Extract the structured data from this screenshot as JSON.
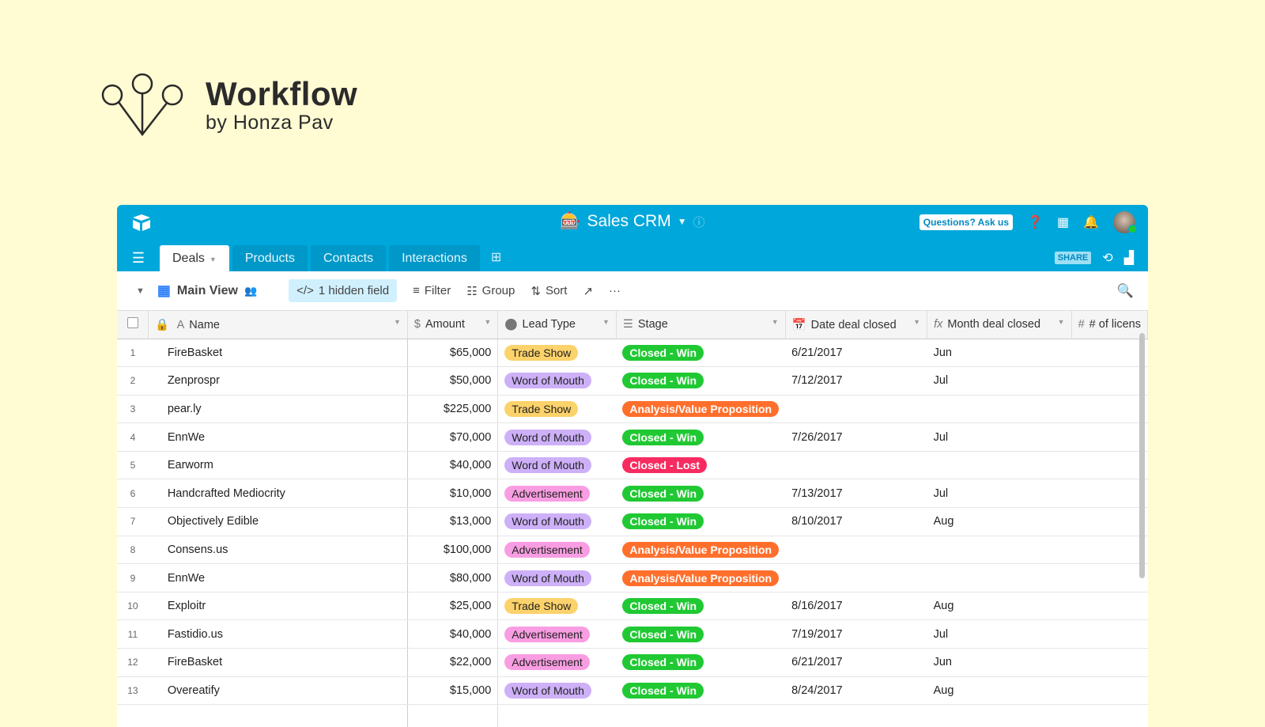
{
  "brand": {
    "title": "Workflow",
    "subtitle": "by Honza Pav"
  },
  "app": {
    "base_name": "Sales CRM",
    "help_button": "Questions? Ask us",
    "share_label": "SHARE",
    "tabs": [
      {
        "label": "Deals",
        "active": true
      },
      {
        "label": "Products"
      },
      {
        "label": "Contacts"
      },
      {
        "label": "Interactions"
      }
    ],
    "toolbar": {
      "view_name": "Main View",
      "hidden_fields": "1 hidden field",
      "filter": "Filter",
      "group": "Group",
      "sort": "Sort",
      "more": "···"
    },
    "columns": [
      "Name",
      "Amount",
      "Lead Type",
      "Stage",
      "Date deal closed",
      "Month deal closed",
      "# of licens"
    ],
    "colors": {
      "header": "#00a7da",
      "trade_show": "#fcd26b",
      "word_of_mouth": "#cdb0f8",
      "advertisement": "#f99de2",
      "closed_win": "#20c933",
      "analysis": "#ff6f2c",
      "closed_lost": "#f82b60"
    },
    "rows": [
      {
        "n": "1",
        "name": "FireBasket",
        "amount": "$65,000",
        "lead": "Trade Show",
        "stage": "Closed - Win",
        "date": "6/21/2017",
        "month": "Jun"
      },
      {
        "n": "2",
        "name": "Zenprospr",
        "amount": "$50,000",
        "lead": "Word of Mouth",
        "stage": "Closed - Win",
        "date": "7/12/2017",
        "month": "Jul"
      },
      {
        "n": "3",
        "name": "pear.ly",
        "amount": "$225,000",
        "lead": "Trade Show",
        "stage": "Analysis/Value Proposition",
        "date": "",
        "month": ""
      },
      {
        "n": "4",
        "name": "EnnWe",
        "amount": "$70,000",
        "lead": "Word of Mouth",
        "stage": "Closed - Win",
        "date": "7/26/2017",
        "month": "Jul"
      },
      {
        "n": "5",
        "name": "Earworm",
        "amount": "$40,000",
        "lead": "Word of Mouth",
        "stage": "Closed - Lost",
        "date": "",
        "month": ""
      },
      {
        "n": "6",
        "name": "Handcrafted Mediocrity",
        "amount": "$10,000",
        "lead": "Advertisement",
        "stage": "Closed - Win",
        "date": "7/13/2017",
        "month": "Jul"
      },
      {
        "n": "7",
        "name": "Objectively Edible",
        "amount": "$13,000",
        "lead": "Word of Mouth",
        "stage": "Closed - Win",
        "date": "8/10/2017",
        "month": "Aug"
      },
      {
        "n": "8",
        "name": "Consens.us",
        "amount": "$100,000",
        "lead": "Advertisement",
        "stage": "Analysis/Value Proposition",
        "date": "",
        "month": ""
      },
      {
        "n": "9",
        "name": "EnnWe",
        "amount": "$80,000",
        "lead": "Word of Mouth",
        "stage": "Analysis/Value Proposition",
        "date": "",
        "month": ""
      },
      {
        "n": "10",
        "name": "Exploitr",
        "amount": "$25,000",
        "lead": "Trade Show",
        "stage": "Closed - Win",
        "date": "8/16/2017",
        "month": "Aug"
      },
      {
        "n": "11",
        "name": "Fastidio.us",
        "amount": "$40,000",
        "lead": "Advertisement",
        "stage": "Closed - Win",
        "date": "7/19/2017",
        "month": "Jul"
      },
      {
        "n": "12",
        "name": "FireBasket",
        "amount": "$22,000",
        "lead": "Advertisement",
        "stage": "Closed - Win",
        "date": "6/21/2017",
        "month": "Jun"
      },
      {
        "n": "13",
        "name": "Overeatify",
        "amount": "$15,000",
        "lead": "Word of Mouth",
        "stage": "Closed - Win",
        "date": "8/24/2017",
        "month": "Aug"
      }
    ]
  }
}
